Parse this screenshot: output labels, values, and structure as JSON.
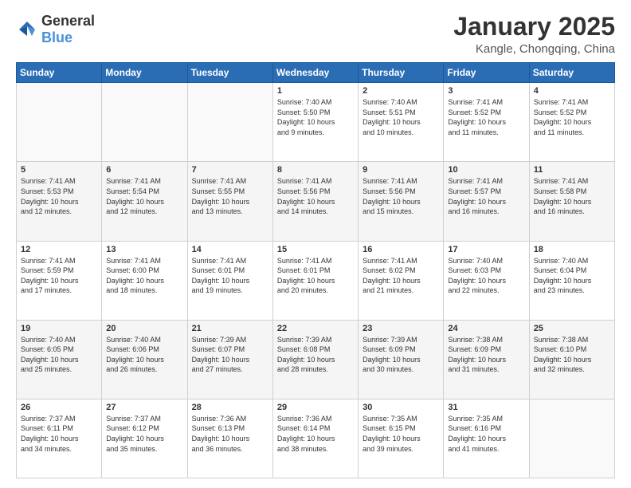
{
  "header": {
    "logo": {
      "general": "General",
      "blue": "Blue"
    },
    "title": "January 2025",
    "subtitle": "Kangle, Chongqing, China"
  },
  "weekdays": [
    "Sunday",
    "Monday",
    "Tuesday",
    "Wednesday",
    "Thursday",
    "Friday",
    "Saturday"
  ],
  "weeks": [
    [
      {
        "day": "",
        "content": ""
      },
      {
        "day": "",
        "content": ""
      },
      {
        "day": "",
        "content": ""
      },
      {
        "day": "1",
        "content": "Sunrise: 7:40 AM\nSunset: 5:50 PM\nDaylight: 10 hours\nand 9 minutes."
      },
      {
        "day": "2",
        "content": "Sunrise: 7:40 AM\nSunset: 5:51 PM\nDaylight: 10 hours\nand 10 minutes."
      },
      {
        "day": "3",
        "content": "Sunrise: 7:41 AM\nSunset: 5:52 PM\nDaylight: 10 hours\nand 11 minutes."
      },
      {
        "day": "4",
        "content": "Sunrise: 7:41 AM\nSunset: 5:52 PM\nDaylight: 10 hours\nand 11 minutes."
      }
    ],
    [
      {
        "day": "5",
        "content": "Sunrise: 7:41 AM\nSunset: 5:53 PM\nDaylight: 10 hours\nand 12 minutes."
      },
      {
        "day": "6",
        "content": "Sunrise: 7:41 AM\nSunset: 5:54 PM\nDaylight: 10 hours\nand 12 minutes."
      },
      {
        "day": "7",
        "content": "Sunrise: 7:41 AM\nSunset: 5:55 PM\nDaylight: 10 hours\nand 13 minutes."
      },
      {
        "day": "8",
        "content": "Sunrise: 7:41 AM\nSunset: 5:56 PM\nDaylight: 10 hours\nand 14 minutes."
      },
      {
        "day": "9",
        "content": "Sunrise: 7:41 AM\nSunset: 5:56 PM\nDaylight: 10 hours\nand 15 minutes."
      },
      {
        "day": "10",
        "content": "Sunrise: 7:41 AM\nSunset: 5:57 PM\nDaylight: 10 hours\nand 16 minutes."
      },
      {
        "day": "11",
        "content": "Sunrise: 7:41 AM\nSunset: 5:58 PM\nDaylight: 10 hours\nand 16 minutes."
      }
    ],
    [
      {
        "day": "12",
        "content": "Sunrise: 7:41 AM\nSunset: 5:59 PM\nDaylight: 10 hours\nand 17 minutes."
      },
      {
        "day": "13",
        "content": "Sunrise: 7:41 AM\nSunset: 6:00 PM\nDaylight: 10 hours\nand 18 minutes."
      },
      {
        "day": "14",
        "content": "Sunrise: 7:41 AM\nSunset: 6:01 PM\nDaylight: 10 hours\nand 19 minutes."
      },
      {
        "day": "15",
        "content": "Sunrise: 7:41 AM\nSunset: 6:01 PM\nDaylight: 10 hours\nand 20 minutes."
      },
      {
        "day": "16",
        "content": "Sunrise: 7:41 AM\nSunset: 6:02 PM\nDaylight: 10 hours\nand 21 minutes."
      },
      {
        "day": "17",
        "content": "Sunrise: 7:40 AM\nSunset: 6:03 PM\nDaylight: 10 hours\nand 22 minutes."
      },
      {
        "day": "18",
        "content": "Sunrise: 7:40 AM\nSunset: 6:04 PM\nDaylight: 10 hours\nand 23 minutes."
      }
    ],
    [
      {
        "day": "19",
        "content": "Sunrise: 7:40 AM\nSunset: 6:05 PM\nDaylight: 10 hours\nand 25 minutes."
      },
      {
        "day": "20",
        "content": "Sunrise: 7:40 AM\nSunset: 6:06 PM\nDaylight: 10 hours\nand 26 minutes."
      },
      {
        "day": "21",
        "content": "Sunrise: 7:39 AM\nSunset: 6:07 PM\nDaylight: 10 hours\nand 27 minutes."
      },
      {
        "day": "22",
        "content": "Sunrise: 7:39 AM\nSunset: 6:08 PM\nDaylight: 10 hours\nand 28 minutes."
      },
      {
        "day": "23",
        "content": "Sunrise: 7:39 AM\nSunset: 6:09 PM\nDaylight: 10 hours\nand 30 minutes."
      },
      {
        "day": "24",
        "content": "Sunrise: 7:38 AM\nSunset: 6:09 PM\nDaylight: 10 hours\nand 31 minutes."
      },
      {
        "day": "25",
        "content": "Sunrise: 7:38 AM\nSunset: 6:10 PM\nDaylight: 10 hours\nand 32 minutes."
      }
    ],
    [
      {
        "day": "26",
        "content": "Sunrise: 7:37 AM\nSunset: 6:11 PM\nDaylight: 10 hours\nand 34 minutes."
      },
      {
        "day": "27",
        "content": "Sunrise: 7:37 AM\nSunset: 6:12 PM\nDaylight: 10 hours\nand 35 minutes."
      },
      {
        "day": "28",
        "content": "Sunrise: 7:36 AM\nSunset: 6:13 PM\nDaylight: 10 hours\nand 36 minutes."
      },
      {
        "day": "29",
        "content": "Sunrise: 7:36 AM\nSunset: 6:14 PM\nDaylight: 10 hours\nand 38 minutes."
      },
      {
        "day": "30",
        "content": "Sunrise: 7:35 AM\nSunset: 6:15 PM\nDaylight: 10 hours\nand 39 minutes."
      },
      {
        "day": "31",
        "content": "Sunrise: 7:35 AM\nSunset: 6:16 PM\nDaylight: 10 hours\nand 41 minutes."
      },
      {
        "day": "",
        "content": ""
      }
    ]
  ]
}
